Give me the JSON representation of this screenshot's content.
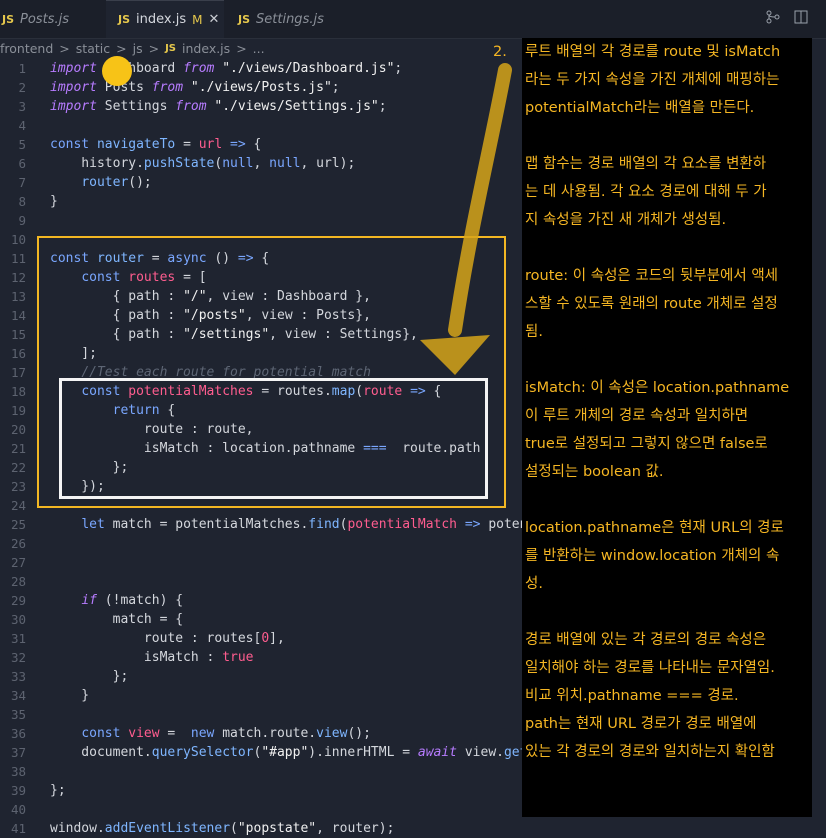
{
  "tabs": [
    {
      "label": "Posts.js",
      "icon": "JS"
    },
    {
      "label": "index.js",
      "icon": "JS",
      "modified": "M",
      "close": "✕"
    },
    {
      "label": "Settings.js",
      "icon": "JS"
    }
  ],
  "top_icons": [
    "source-control-icon",
    "split-editor-icon"
  ],
  "breadcrumb": {
    "parts": [
      "frontend",
      "static",
      "js",
      "index.js",
      "..."
    ],
    "sep": ">"
  },
  "code_lines": [
    {
      "n": "1",
      "html": "<span class='k'>import</span> Dashboard <span class='k'>from</span> <span class='str'>\"./views/Dashboard.js\"</span>;"
    },
    {
      "n": "2",
      "html": "<span class='k'>import</span> Posts <span class='k'>from</span> <span class='str'>\"./views/Posts.js\"</span>;"
    },
    {
      "n": "3",
      "html": "<span class='k'>import</span> Settings <span class='k'>from</span> <span class='str'>\"./views/Settings.js\"</span>;"
    },
    {
      "n": "4",
      "html": ""
    },
    {
      "n": "5",
      "html": "<span class='kw'>const</span> <span class='f'>navigateTo</span> = <span class='v'>url</span> <span class='kw'>=&gt;</span> {"
    },
    {
      "n": "6",
      "html": "    history.<span class='f'>pushState</span>(<span class='kw'>null</span>, <span class='kw'>null</span>, url);"
    },
    {
      "n": "7",
      "html": "    <span class='f'>router</span>();"
    },
    {
      "n": "8",
      "html": "}"
    },
    {
      "n": "9",
      "html": ""
    },
    {
      "n": "10",
      "html": ""
    },
    {
      "n": "11",
      "html": "<span class='kw'>const</span> <span class='f'>router</span> = <span class='kw'>async</span> () <span class='kw'>=&gt;</span> {"
    },
    {
      "n": "12",
      "html": "    <span class='kw'>const</span> <span class='v'>routes</span> = ["
    },
    {
      "n": "13",
      "html": "        { path : <span class='str'>\"/\"</span>, view : Dashboard },"
    },
    {
      "n": "14",
      "html": "        { path : <span class='str'>\"/posts\"</span>, view : Posts},"
    },
    {
      "n": "15",
      "html": "        { path : <span class='str'>\"/settings\"</span>, view : Settings},"
    },
    {
      "n": "16",
      "html": "    ];"
    },
    {
      "n": "17",
      "html": "    <span class='c'>//Test each route for potential match</span>"
    },
    {
      "n": "18",
      "html": "    <span class='kw'>const</span> <span class='v'>potentialMatches</span> = routes.<span class='f'>map</span>(<span class='v'>route</span> <span class='kw'>=&gt;</span> {"
    },
    {
      "n": "19",
      "html": "        <span class='kw'>return</span> {"
    },
    {
      "n": "20",
      "html": "            route : route,"
    },
    {
      "n": "21",
      "html": "            isMatch : location.pathname <span class='kw'>===</span>  route.path"
    },
    {
      "n": "22",
      "html": "        };"
    },
    {
      "n": "23",
      "html": "    });"
    },
    {
      "n": "24",
      "html": ""
    },
    {
      "n": "25",
      "html": "    <span class='kw'>let</span> match = potentialMatches.<span class='f'>find</span>(<span class='v'>potentialMatch</span> <span class='kw'>=&gt;</span> potentialMatch"
    },
    {
      "n": "26",
      "html": ""
    },
    {
      "n": "27",
      "html": ""
    },
    {
      "n": "28",
      "html": ""
    },
    {
      "n": "29",
      "html": "    <span class='k'>if</span> (!match) {"
    },
    {
      "n": "30",
      "html": "        match = {"
    },
    {
      "n": "31",
      "html": "            route : routes[<span class='v'>0</span>],"
    },
    {
      "n": "32",
      "html": "            isMatch : <span class='v'>true</span>"
    },
    {
      "n": "33",
      "html": "        };"
    },
    {
      "n": "34",
      "html": "    }"
    },
    {
      "n": "35",
      "html": ""
    },
    {
      "n": "36",
      "html": "    <span class='kw'>const</span> <span class='v'>view</span> =  <span class='kw'>new</span> match.route.<span class='f'>view</span>();"
    },
    {
      "n": "37",
      "html": "    document.<span class='f'>querySelector</span>(<span class='str'>\"#app\"</span>).innerHTML = <span class='k'>await</span> view.<span class='f'>getHtml</span>();"
    },
    {
      "n": "38",
      "html": ""
    },
    {
      "n": "39",
      "html": "};"
    },
    {
      "n": "40",
      "html": ""
    },
    {
      "n": "41",
      "html": "window.<span class='f'>addEventListener</span>(<span class='str'>\"popstate\"</span>, router);"
    }
  ],
  "annotation": {
    "step": "2.",
    "lines": [
      "루트 배열의 각 경로를 route 및 isMatch",
      "라는 두 가지 속성을 가진 개체에 매핑하는",
      "potentialMatch라는 배열을 만든다.",
      "",
      "맵 함수는 경로 배열의 각 요소를 변환하",
      "는 데 사용됨. 각 요소 경로에 대해 두 가",
      "지 속성을 가진 새 개체가 생성됨.",
      "",
      "route: 이 속성은 코드의 뒷부분에서 액세",
      "스할 수 있도록 원래의 route 개체로 설정",
      "됨.",
      "",
      "isMatch: 이 속성은 location.pathname",
      "이 루트 개체의 경로 속성과 일치하면",
      "true로 설정되고 그렇지 않으면 false로",
      "설정되는 boolean 값.",
      "",
      "location.pathname은 현재 URL의 경로",
      "를 반환하는 window.location 개체의 속",
      "성.",
      "",
      "경로 배열에 있는 각 경로의 경로 속성은",
      "일치해야 하는 경로를 나타내는 문자열임.",
      "비교 위치.pathname === 경로.",
      "path는 현재 URL 경로가 경로 배열에",
      "있는 각 경로의 경로와 일치하는지 확인함"
    ]
  }
}
